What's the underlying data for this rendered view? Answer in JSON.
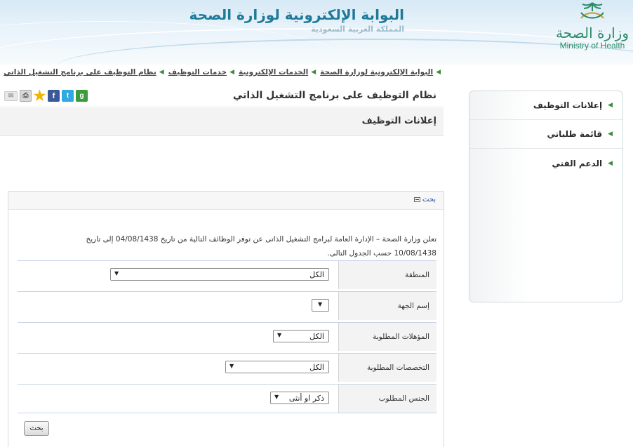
{
  "header": {
    "portal_title": "البوابة الإلكترونية لوزارة الصحة",
    "portal_subtitle": "المملكة العربية السعودية",
    "logo_ar": "وزارة الصحة",
    "logo_en": "Ministry of Health",
    "logo_icon": "palm-swords-emblem"
  },
  "breadcrumb": [
    {
      "label": "البوابة الإلكترونية لوزارة الصحة"
    },
    {
      "label": "الخدمات الإلكترونية"
    },
    {
      "label": "خدمات التوظيف"
    },
    {
      "label": "نظام التوظيف على برنامج التشغيل الذاتي"
    }
  ],
  "sidebar": {
    "items": [
      {
        "label": "إعلانات التوظيف"
      },
      {
        "label": "قائمة طلباتي"
      },
      {
        "label": "الدعم الفني"
      }
    ]
  },
  "page": {
    "title": "نظام التوظيف على برنامج التشغيل الذاتي",
    "share_icons": [
      "mail-icon",
      "print-icon",
      "favorite-star-icon",
      "facebook-icon",
      "twitter-icon",
      "google-icon"
    ],
    "section_title": "إعلانات التوظيف"
  },
  "search": {
    "toggle_label": "بحث",
    "intro_line1": "تعلن وزارة الصحة – الإدارة العامة لبرامج التشغيل الذاتى عن توفر الوظائف التالية من تاريخ 04/08/1438 إلى تاريخ",
    "intro_line2": "10/08/1438 حسب الجدول التالى.",
    "fields": [
      {
        "label": "المنطقة",
        "value": "الكل"
      },
      {
        "label": "إسم الجهة",
        "value": ""
      },
      {
        "label": "المؤهلات المطلوبة",
        "value": "الكل"
      },
      {
        "label": "التخصصات المطلوبة",
        "value": "الكل"
      },
      {
        "label": "الجنس المطلوب",
        "value": "ذكر او أنثى"
      }
    ],
    "submit_label": "بحث"
  },
  "colors": {
    "title_blue": "#1f7a9a",
    "logo_green": "#2d8b6a",
    "arrow_green": "#3c8c3c"
  }
}
